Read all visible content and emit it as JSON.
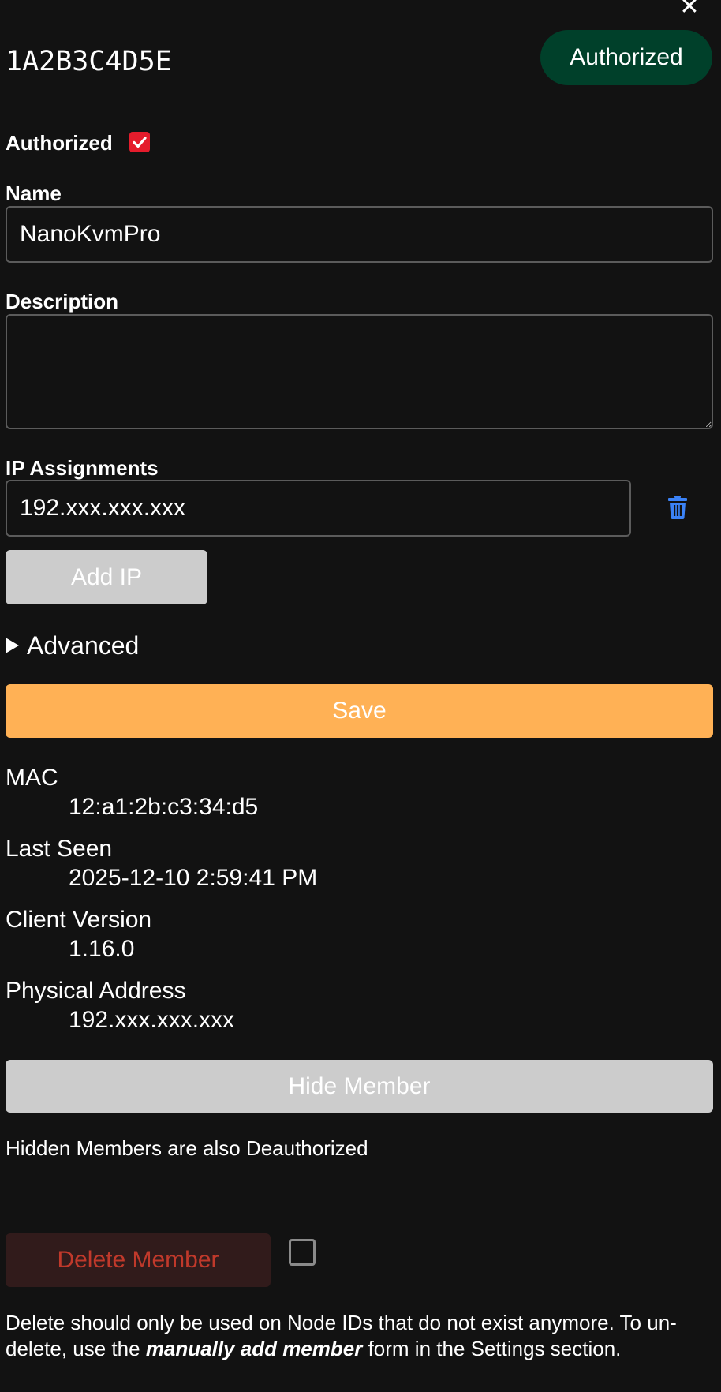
{
  "header": {
    "close_glyph": "✕",
    "node_id": "1A2B3C4D5E",
    "status_badge": "Authorized"
  },
  "form": {
    "authorized_label": "Authorized",
    "authorized_checked": true,
    "name_label": "Name",
    "name_value": "NanoKvmPro",
    "description_label": "Description",
    "description_value": "",
    "ip_label": "IP Assignments",
    "ip_values": [
      "192.xxx.xxx.xxx"
    ],
    "add_ip_label": "Add IP",
    "advanced_label": "Advanced",
    "save_label": "Save"
  },
  "info": {
    "mac_label": "MAC",
    "mac_value": "12:a1:2b:c3:34:d5",
    "last_seen_label": "Last Seen",
    "last_seen_value": "2025-12-10 2:59:41 PM",
    "client_version_label": "Client Version",
    "client_version_value": "1.16.0",
    "physical_address_label": "Physical Address",
    "physical_address_value": "192.xxx.xxx.xxx"
  },
  "hide": {
    "button_label": "Hide Member",
    "note": "Hidden Members are also Deauthorized"
  },
  "delete": {
    "button_label": "Delete Member",
    "note_before": "Delete should only be used on Node IDs that do not exist anymore. To un-delete, use the ",
    "note_emphasis": "manually add member",
    "note_after": " form in the Settings section."
  },
  "colors": {
    "background": "#121212",
    "badge": "#00402a",
    "save": "#ffb155",
    "delete_text": "#c0392b",
    "checkbox": "#e51c2c",
    "trash": "#3b82f6"
  },
  "icons": {
    "close": "close-icon",
    "checkbox": "checkmark-icon",
    "trash": "trash-icon",
    "advanced": "triangle-right-icon"
  }
}
